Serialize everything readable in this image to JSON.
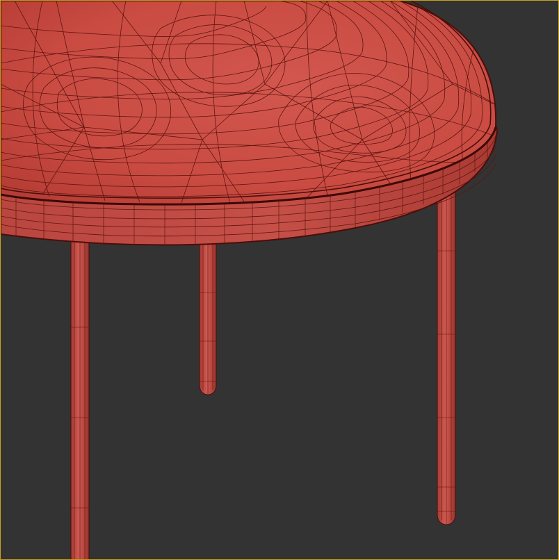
{
  "viewport": {
    "background_color": "#333333",
    "active_border_color": "#c8a21e",
    "selection_state": "active-viewport"
  },
  "model": {
    "object": "side-table",
    "display_mode": "shaded-with-wireframe",
    "parts": [
      "tabletop",
      "leg",
      "leg",
      "leg"
    ],
    "surface_color": "#c94b42",
    "edge_color": "#4a0e0a"
  }
}
